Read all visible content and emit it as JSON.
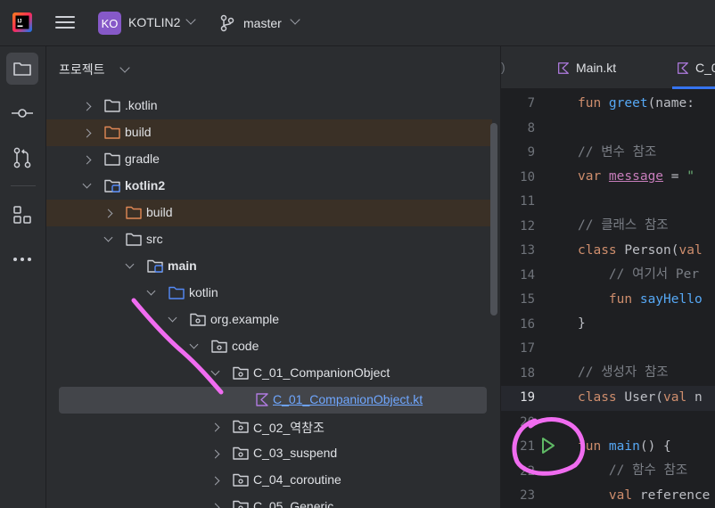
{
  "titlebar": {
    "project_badge": "KO",
    "project_name": "KOTLIN2",
    "branch": "master"
  },
  "stripe": {
    "tools": [
      "folder-icon",
      "commit-icon",
      "pull-requests-icon",
      "structure-icon",
      "more-icon"
    ]
  },
  "panel": {
    "header": "프로젝트",
    "tree": [
      {
        "label": ".kotlin",
        "icon": "folder-icon"
      },
      {
        "label": "build",
        "icon": "folder-icon",
        "excluded": true
      },
      {
        "label": "gradle",
        "icon": "folder-icon"
      },
      {
        "label": "kotlin2",
        "icon": "module-icon"
      },
      {
        "label": "build",
        "icon": "folder-icon",
        "excluded": true
      },
      {
        "label": "src",
        "icon": "folder-icon"
      },
      {
        "label": "main",
        "icon": "module-icon"
      },
      {
        "label": "kotlin",
        "icon": "source-folder-icon"
      },
      {
        "label": "org.example",
        "icon": "package-icon"
      },
      {
        "label": "code",
        "icon": "package-icon"
      },
      {
        "label": "C_01_CompanionObject",
        "icon": "package-icon"
      },
      {
        "label": "C_01_CompanionObject.kt",
        "icon": "kotlin-file-icon"
      },
      {
        "label": "C_02_역참조",
        "icon": "package-icon"
      },
      {
        "label": "C_03_suspend",
        "icon": "package-icon"
      },
      {
        "label": "C_04_coroutine",
        "icon": "package-icon"
      },
      {
        "label": "C_05_Generic",
        "icon": "package-icon"
      }
    ]
  },
  "tabs": [
    {
      "label": "Main.kt"
    },
    {
      "label": "C_0"
    }
  ],
  "editor": {
    "line_numbers": [
      "7",
      "8",
      "9",
      "10",
      "11",
      "12",
      "13",
      "14",
      "15",
      "16",
      "17",
      "18",
      "19",
      "20",
      "21",
      "22",
      "23"
    ],
    "current_line": "19",
    "code": {
      "l7_kw": "fun ",
      "l7_fn": "greet",
      "l7_rest": "(name:",
      "l9": "// 변수 참조",
      "l10_kw": "var ",
      "l10_prop": "message",
      "l10_rest": " = ",
      "l10_str": "\"",
      "l12": "// 클래스 참조",
      "l13_kw": "class ",
      "l13_rest": "Person(",
      "l13_kw2": "val",
      "l14": "    // 여기서 Per",
      "l15_kw": "    fun ",
      "l15_fn": "sayHello",
      "l16": "}",
      "l18": "// 생성자 참조",
      "l19_kw": "class ",
      "l19_rest": "User(",
      "l19_kw2": "val ",
      "l19_rest2": "n",
      "l21_kw": "fun ",
      "l21_fn": "main",
      "l21_rest": "() {",
      "l22": "    // 함수 참조",
      "l23_kw": "    val ",
      "l23_rest": "reference"
    }
  },
  "colors": {
    "accent": "#3574f0",
    "annotation": "#f06cf0",
    "project_badge": "#8659c8"
  }
}
